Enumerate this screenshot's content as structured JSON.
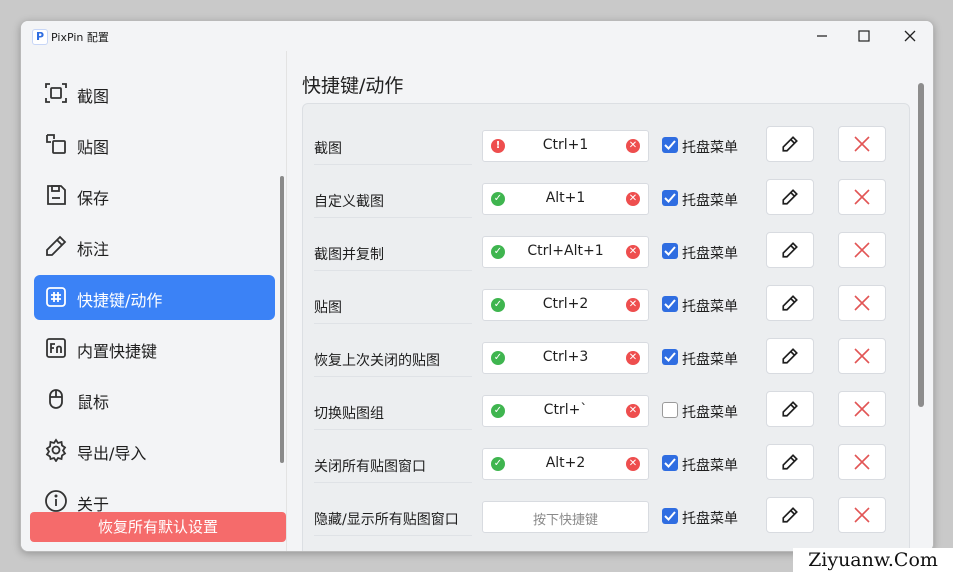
{
  "window": {
    "title": "PixPin 配置",
    "app_icon_letter": "P"
  },
  "controls": {
    "minimize": "─",
    "maximize": "☐",
    "close": "✕"
  },
  "sidebar": {
    "items": [
      {
        "label": "截图",
        "icon": "screenshot-icon"
      },
      {
        "label": "贴图",
        "icon": "pin-icon"
      },
      {
        "label": "保存",
        "icon": "save-icon"
      },
      {
        "label": "标注",
        "icon": "pencil-icon"
      },
      {
        "label": "快捷键/动作",
        "icon": "hashtag-icon",
        "active": true
      },
      {
        "label": "内置快捷键",
        "icon": "fn-key-icon"
      },
      {
        "label": "鼠标",
        "icon": "mouse-icon"
      },
      {
        "label": "导出/导入",
        "icon": "gear-icon"
      },
      {
        "label": "关于",
        "icon": "info-icon"
      }
    ],
    "reset_button": "恢复所有默认设置"
  },
  "main": {
    "title": "快捷键/动作",
    "rows": [
      {
        "label": "截图",
        "key": "Ctrl+1",
        "status": "error",
        "tray": true,
        "tray_label": "托盘菜单"
      },
      {
        "label": "自定义截图",
        "key": "Alt+1",
        "status": "ok",
        "tray": true,
        "tray_label": "托盘菜单"
      },
      {
        "label": "截图并复制",
        "key": "Ctrl+Alt+1",
        "status": "ok",
        "tray": true,
        "tray_label": "托盘菜单"
      },
      {
        "label": "贴图",
        "key": "Ctrl+2",
        "status": "ok",
        "tray": true,
        "tray_label": "托盘菜单"
      },
      {
        "label": "恢复上次关闭的贴图",
        "key": "Ctrl+3",
        "status": "ok",
        "tray": true,
        "tray_label": "托盘菜单"
      },
      {
        "label": "切换贴图组",
        "key": "Ctrl+`",
        "status": "ok",
        "tray": false,
        "tray_label": "托盘菜单"
      },
      {
        "label": "关闭所有贴图窗口",
        "key": "Alt+2",
        "status": "ok",
        "tray": true,
        "tray_label": "托盘菜单"
      },
      {
        "label": "隐藏/显示所有贴图窗口",
        "key": "",
        "placeholder": "按下快捷键",
        "status": "none",
        "tray": true,
        "tray_label": "托盘菜单"
      }
    ]
  },
  "colors": {
    "accent": "#3b82f6",
    "danger": "#f56b6b",
    "ok": "#3fb54f",
    "error": "#ee4e4e"
  },
  "watermark": "Ziyuanw.Com"
}
